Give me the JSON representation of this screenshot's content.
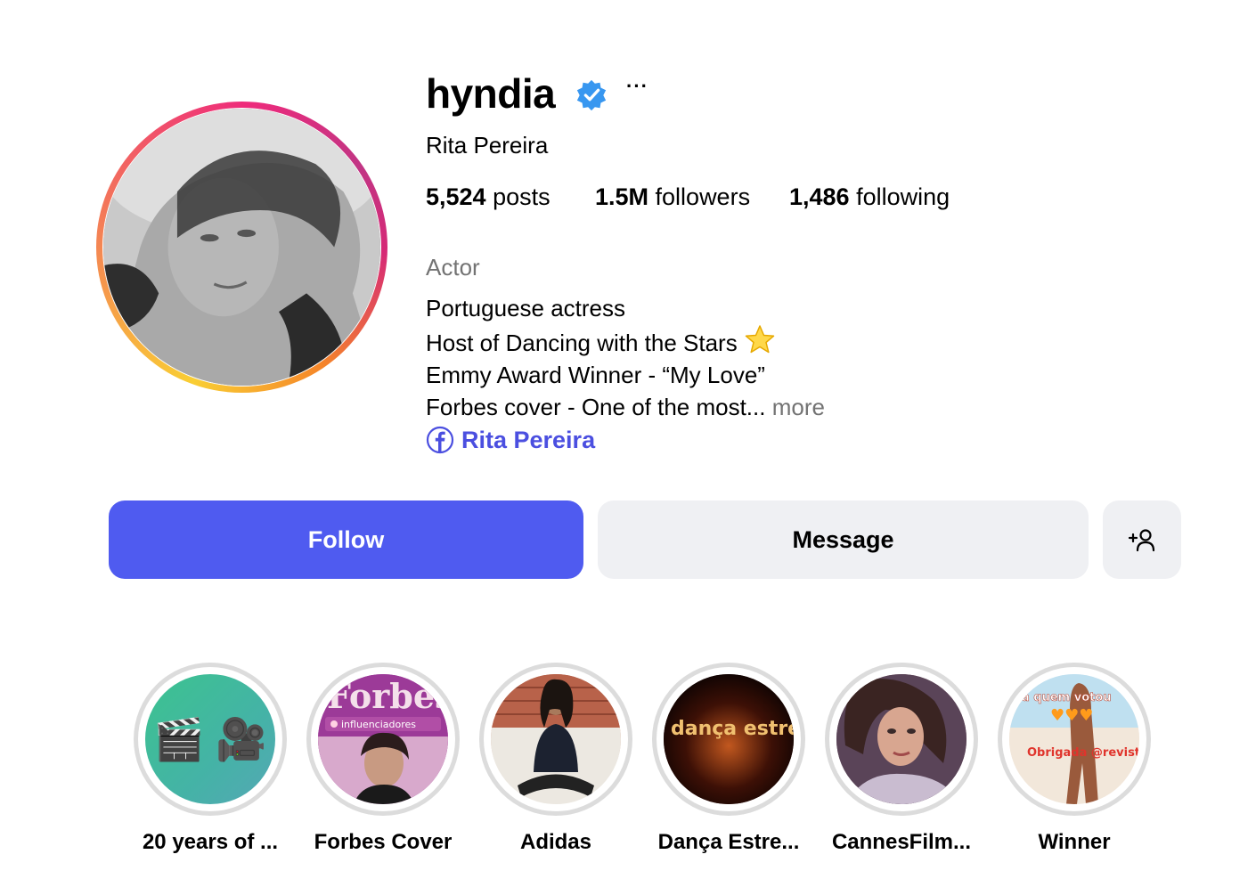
{
  "profile": {
    "username": "hyndia",
    "verified": true,
    "more_label": "···",
    "full_name": "Rita Pereira",
    "stats": {
      "posts_count": "5,524",
      "posts_label": " posts",
      "followers_count": "1.5M",
      "followers_label": " followers",
      "following_count": "1,486",
      "following_label": " following"
    },
    "category": "Actor",
    "bio_lines": [
      "Portuguese actress",
      "Host of Dancing with the Stars",
      "Emmy Award Winner - “My Love”",
      "Forbes cover - One of the most... "
    ],
    "bio_more": "more",
    "link": {
      "icon": "facebook-icon",
      "text": "Rita Pereira"
    }
  },
  "actions": {
    "follow_label": "Follow",
    "message_label": "Message",
    "add_user_icon": "add-user-icon"
  },
  "highlights": [
    {
      "label": "20 years of ...",
      "cover_text": "🎬 🎥"
    },
    {
      "label": "Forbes Cover",
      "cover_text": "Forbes",
      "cover_sub": "influenciadores"
    },
    {
      "label": "Adidas"
    },
    {
      "label": "Dança Estre...",
      "cover_text": "dança estrelas"
    },
    {
      "label": "CannesFilm..."
    },
    {
      "label": "Winner",
      "cover_text": "Obrigada @revistalux",
      "cover_top": "a quem votou"
    }
  ],
  "colors": {
    "accent": "#4f5bf0",
    "link": "#4b4fe0",
    "muted": "#737373",
    "button_secondary": "#eff0f3",
    "verified": "#3897f0"
  }
}
